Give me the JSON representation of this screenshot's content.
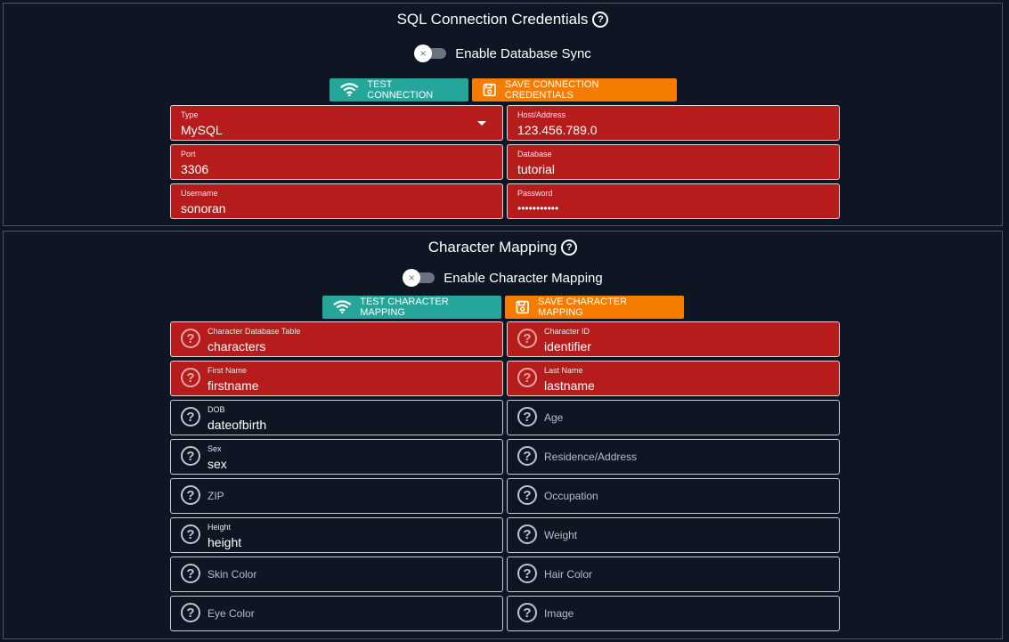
{
  "sql": {
    "title": "SQL Connection Credentials",
    "toggle_label": "Enable Database Sync",
    "test_button": "TEST CONNECTION",
    "save_button": "SAVE CONNECTION CREDENTIALS",
    "fields": {
      "type": {
        "label": "Type",
        "value": "MySQL"
      },
      "host": {
        "label": "Host/Address",
        "value": "123.456.789.0"
      },
      "port": {
        "label": "Port",
        "value": "3306"
      },
      "database": {
        "label": "Database",
        "value": "tutorial"
      },
      "username": {
        "label": "Username",
        "value": "sonoran"
      },
      "password": {
        "label": "Password",
        "value": "•••••••••••"
      }
    }
  },
  "mapping": {
    "title": "Character Mapping",
    "toggle_label": "Enable Character Mapping",
    "test_button": "TEST CHARACTER MAPPING",
    "save_button": "SAVE CHARACTER MAPPING",
    "fields": {
      "table": {
        "label": "Character Database Table",
        "value": "characters"
      },
      "id": {
        "label": "Character ID",
        "value": "identifier"
      },
      "first": {
        "label": "First Name",
        "value": "firstname"
      },
      "last": {
        "label": "Last Name",
        "value": "lastname"
      },
      "dob": {
        "label": "DOB",
        "value": "dateofbirth"
      },
      "age": {
        "placeholder": "Age"
      },
      "sex": {
        "label": "Sex",
        "value": "sex"
      },
      "residence": {
        "placeholder": "Residence/Address"
      },
      "zip": {
        "placeholder": "ZIP"
      },
      "occupation": {
        "placeholder": "Occupation"
      },
      "height": {
        "label": "Height",
        "value": "height"
      },
      "weight": {
        "placeholder": "Weight"
      },
      "skin": {
        "placeholder": "Skin Color"
      },
      "hair": {
        "placeholder": "Hair Color"
      },
      "eye": {
        "placeholder": "Eye Color"
      },
      "image": {
        "placeholder": "Image"
      }
    }
  },
  "icons": {
    "help": "?",
    "toggle_off": "×"
  },
  "colors": {
    "background": "#0e1623",
    "required_field": "#b71c1c",
    "teal_button": "#26a69a",
    "orange_button": "#f57c00"
  }
}
